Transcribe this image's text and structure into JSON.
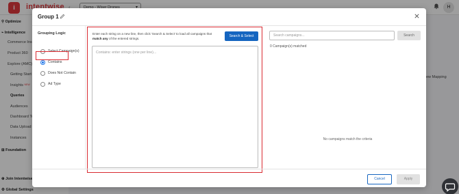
{
  "app": {
    "brand": "intentwise",
    "logo_letter": "i",
    "account_select": "Demo - Wiser Drones",
    "avatar_initial": "H"
  },
  "sidebar": {
    "items": [
      {
        "label": "Optimize"
      },
      {
        "label": "Intelligence"
      },
      {
        "label": "Commerce Insi"
      },
      {
        "label": "Product 360"
      },
      {
        "label": "Explore (AMC)"
      },
      {
        "label": "Getting Start"
      },
      {
        "label": "Insights",
        "tag": "NEW"
      },
      {
        "label": "Queries"
      },
      {
        "label": "Audiences"
      },
      {
        "label": "Dashboard Te"
      },
      {
        "label": "Data Upload"
      },
      {
        "label": "Instances"
      },
      {
        "label": "Foundation"
      },
      {
        "label": "Join Intentwise C"
      },
      {
        "label": "Global Settings"
      }
    ]
  },
  "background_right_label": "ew Mapping",
  "modal": {
    "title": "Group 1",
    "grouping_logic": {
      "title": "Grouping Logic",
      "options": [
        {
          "label": "Select Campaign(s)",
          "checked": false
        },
        {
          "label": "Contains",
          "checked": true
        },
        {
          "label": "Does Not Contain",
          "checked": false
        },
        {
          "label": "Ad Type",
          "checked": false
        }
      ]
    },
    "instructions": {
      "part1": "Enter each string on a new line, then click 'Search & Select' to load all campaigns that",
      "bold": "match any",
      "part2": "of the entered strings."
    },
    "search_select_label": "Search & Select",
    "contains_placeholder": "Contains: enter strings (one per line)...",
    "campaign_search_placeholder": "Search campaigns...",
    "search_label": "Search",
    "matched_text": "0 Campaign(s) matched",
    "no_match_text": "No campaigns match the criteria",
    "cancel_label": "Cancel",
    "apply_label": "Apply"
  },
  "colors": {
    "brand_red": "#e0393e",
    "primary_blue": "#1565c0",
    "highlight_red": "#d9292f"
  }
}
